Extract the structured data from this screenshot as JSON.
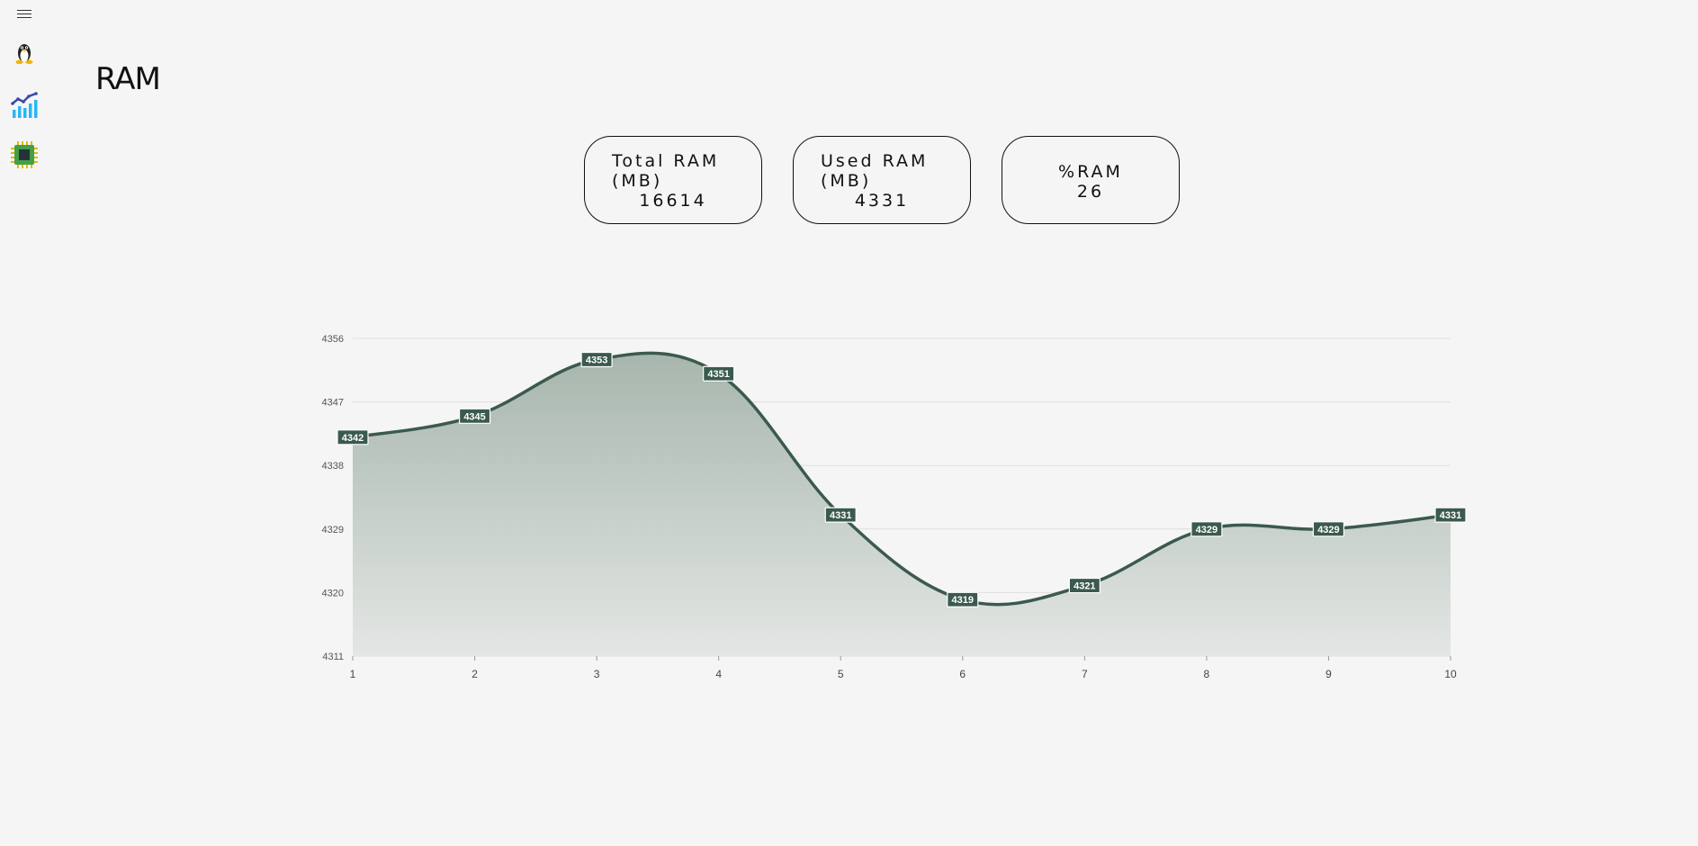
{
  "sidebar": {
    "menu_icon": "hamburger-menu-icon",
    "items": [
      {
        "icon": "linux-penguin-icon"
      },
      {
        "icon": "chart-stats-icon"
      },
      {
        "icon": "cpu-chip-icon"
      }
    ]
  },
  "page": {
    "title": "RAM"
  },
  "cards": {
    "total": {
      "label": "Total RAM (MB)",
      "value": "16614"
    },
    "used": {
      "label": "Used RAM (MB)",
      "value": "4331"
    },
    "percent": {
      "label": "%RAM",
      "value": "26"
    }
  },
  "colors": {
    "line": "#3b5a4e",
    "fill_top": "#a7b6ad",
    "fill_bottom": "#e3e6e4",
    "label_bg": "#3b5a4e",
    "background": "#f5f5f5"
  },
  "chart_data": {
    "type": "area",
    "x": [
      "1",
      "2",
      "3",
      "4",
      "5",
      "6",
      "7",
      "8",
      "9",
      "10"
    ],
    "series": [
      {
        "values": [
          4342,
          4345,
          4353,
          4351,
          4331,
          4319,
          4321,
          4329,
          4329,
          4331
        ]
      }
    ],
    "yticks": [
      "4311",
      "4320",
      "4329",
      "4338",
      "4347",
      "4356"
    ],
    "ylim": [
      4311,
      4356
    ],
    "grid": true,
    "data_labels": true,
    "smooth": true
  }
}
